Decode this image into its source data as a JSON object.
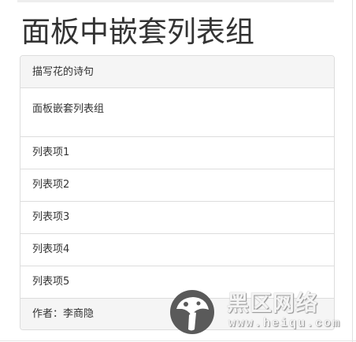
{
  "page": {
    "title": "面板中嵌套列表组"
  },
  "panel": {
    "heading": "描写花的诗句",
    "body": "面板嵌套列表组",
    "items": [
      {
        "label": "列表项1"
      },
      {
        "label": "列表项2"
      },
      {
        "label": "列表项3"
      },
      {
        "label": "列表项4"
      },
      {
        "label": "列表项5"
      }
    ],
    "footer": "作者：李商隐"
  },
  "watermark": {
    "name": "黑区网络",
    "url": "www.heiqu.com",
    "logo_icon": "mushroom-logo-icon"
  },
  "colors": {
    "text": "#333333",
    "panel_border": "#dddddd",
    "panel_heading_bg": "#f5f5f5",
    "watermark_dark": "#555555"
  }
}
